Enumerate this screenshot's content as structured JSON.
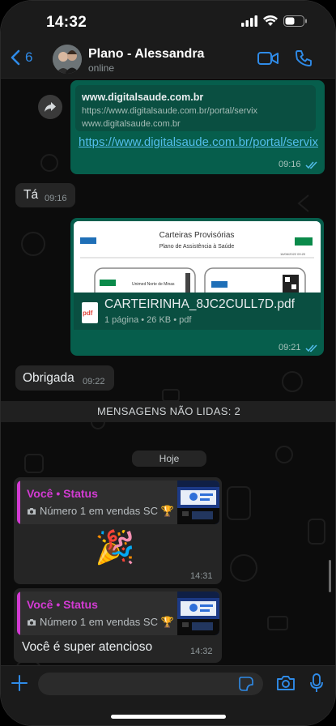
{
  "statusbar": {
    "time": "14:32"
  },
  "header": {
    "back_count": "6",
    "contact_name": "Plano - Alessandra",
    "contact_status": "online"
  },
  "messages": {
    "link": {
      "preview_domain": "www.digitalsaude.com.br",
      "preview_url": "https://www.digitalsaude.com.br/portal/servix",
      "preview_url_short": "www.digitalsaude.com.br",
      "text": "https://www.digitalsaude.com.br/portal/servix",
      "time": "09:16"
    },
    "ta": {
      "text": "Tá",
      "time": "09:16"
    },
    "pdf": {
      "doc_title": "Carteiras Provisórias",
      "doc_subtitle": "Plano de Assistência à Saúde",
      "doc_date": "16/06/2022 09:20",
      "doc_card_text": "Unimed Norte de Minas",
      "file_name": "CARTEIRINHA_8JC2CULL7D.pdf",
      "file_info": "1 página • 26 KB • pdf",
      "time": "09:21"
    },
    "obrigada": {
      "text": "Obrigada",
      "time": "09:22"
    },
    "unread_label": "MENSAGENS NÃO LIDAS: 2",
    "day_label": "Hoje",
    "status1": {
      "quote_title": "Você • Status",
      "quote_subtitle": "Número 1 em vendas SC 🏆",
      "emoji": "🎉",
      "time": "14:31"
    },
    "status2": {
      "quote_title": "Você • Status",
      "quote_subtitle": "Número 1 em vendas SC 🏆",
      "text": "Você é super atencioso",
      "time": "14:32"
    }
  },
  "colors": {
    "accent": "#2f8be8",
    "outgoing_bubble": "#065e4c",
    "incoming_bubble": "#252525",
    "status_accent": "#d33bd3",
    "link": "#53bdeb",
    "read_ticks": "#53bdeb"
  }
}
